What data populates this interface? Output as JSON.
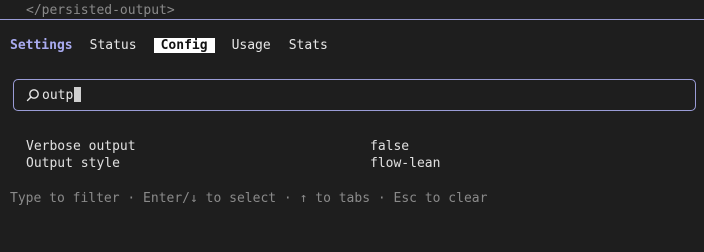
{
  "previous_output": "</persisted-output>",
  "nav": {
    "title": "Settings",
    "tabs": [
      {
        "label": "Status",
        "active": false
      },
      {
        "label": "Config",
        "active": true
      },
      {
        "label": "Usage",
        "active": false
      },
      {
        "label": "Stats",
        "active": false
      }
    ]
  },
  "search": {
    "icon": "search-icon",
    "value": "outp"
  },
  "results": [
    {
      "label": "Verbose output",
      "value": "false"
    },
    {
      "label": "Output style",
      "value": "flow-lean"
    }
  ],
  "hint": "Type to filter · Enter/↓ to select · ↑ to tabs · Esc to clear",
  "colors": {
    "background": "#1e1e1e",
    "accent": "#9a9cd6",
    "settings_label": "#a9abf0",
    "active_tab_bg": "#ffffff",
    "muted_text": "#8a8a8a"
  }
}
